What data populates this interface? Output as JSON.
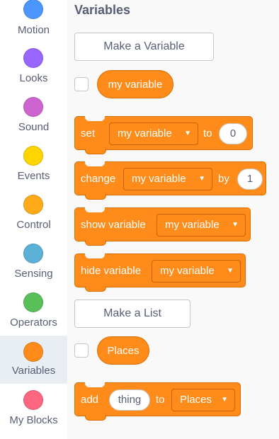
{
  "sidebar": {
    "categories": [
      {
        "label": "Motion",
        "color": "#4c97ff"
      },
      {
        "label": "Looks",
        "color": "#9966ff"
      },
      {
        "label": "Sound",
        "color": "#cf63cf"
      },
      {
        "label": "Events",
        "color": "#ffd500"
      },
      {
        "label": "Control",
        "color": "#ffab19"
      },
      {
        "label": "Sensing",
        "color": "#5cb1d6"
      },
      {
        "label": "Operators",
        "color": "#59c059"
      },
      {
        "label": "Variables",
        "color": "#ff8c1a",
        "selected": true
      },
      {
        "label": "My Blocks",
        "color": "#ff6680"
      }
    ]
  },
  "flyout": {
    "title": "Variables",
    "make_variable_label": "Make a Variable",
    "variable_reporter": "my variable",
    "set_block": {
      "prefix": "set",
      "variable": "my variable",
      "to": "to",
      "value": "0"
    },
    "change_block": {
      "prefix": "change",
      "variable": "my variable",
      "by": "by",
      "value": "1"
    },
    "show_block": {
      "prefix": "show variable",
      "variable": "my variable"
    },
    "hide_block": {
      "prefix": "hide variable",
      "variable": "my variable"
    },
    "make_list_label": "Make a List",
    "list_reporter": "Places",
    "add_block": {
      "prefix": "add",
      "item": "thing",
      "to": "to",
      "list": "Places"
    }
  },
  "colors": {
    "variables_block": "#ff8c1a",
    "variables_block_border": "#db6e00",
    "text_gray": "#575e75"
  }
}
